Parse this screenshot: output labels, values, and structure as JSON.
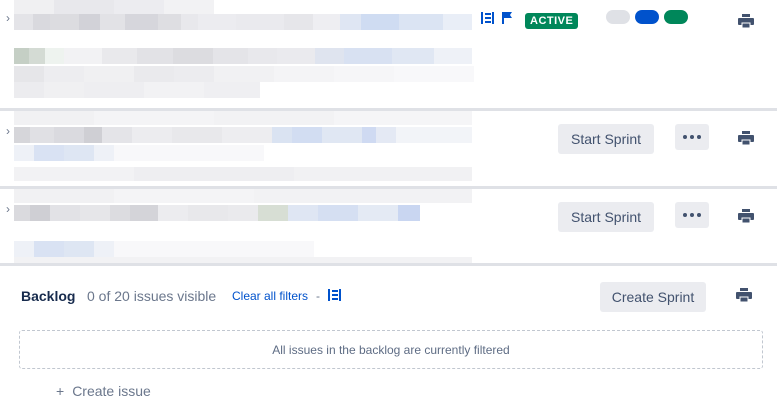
{
  "sprints": [
    {
      "status_badge": "ACTIVE",
      "pill_colors": [
        "#dfe1e6",
        "#0052cc",
        "#00875a"
      ]
    },
    {
      "action_label": "Start Sprint"
    },
    {
      "action_label": "Start Sprint"
    }
  ],
  "backlog": {
    "title": "Backlog",
    "count_text": "0 of 20 issues visible",
    "clear_filters_label": "Clear all filters",
    "separator": "-",
    "create_sprint_label": "Create Sprint",
    "empty_message": "All issues in the backlog are currently filtered",
    "create_issue_label": "Create issue",
    "create_issue_prefix": "+"
  },
  "colors": {
    "accent": "#0052cc",
    "active": "#00875a",
    "divider": "#dfe1e6",
    "button_bg": "#ebecf0"
  }
}
